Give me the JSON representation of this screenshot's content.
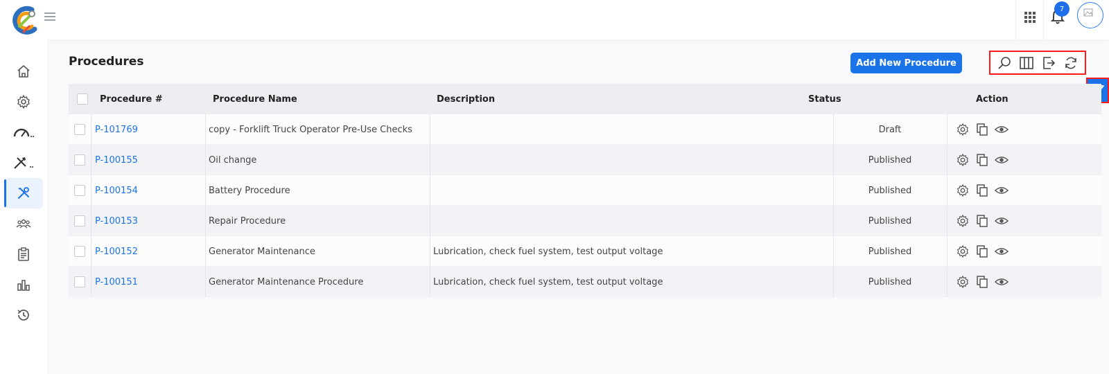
{
  "page": {
    "title": "Procedures"
  },
  "header": {
    "notification_count": "7"
  },
  "toolbar": {
    "add_label": "Add New Procedure"
  },
  "table": {
    "columns": [
      "Procedure #",
      "Procedure Name",
      "Description",
      "Status",
      "Action"
    ],
    "rows": [
      {
        "id": "P-101769",
        "name": "copy - Forklift Truck Operator Pre-Use Checks",
        "description": "",
        "status": "Draft"
      },
      {
        "id": "P-100155",
        "name": "Oil change",
        "description": "",
        "status": "Published"
      },
      {
        "id": "P-100154",
        "name": "Battery Procedure",
        "description": "",
        "status": "Published"
      },
      {
        "id": "P-100153",
        "name": "Repair Procedure",
        "description": "",
        "status": "Published"
      },
      {
        "id": "P-100152",
        "name": "Generator Maintenance",
        "description": "Lubrication, check fuel system, test output voltage",
        "status": "Published"
      },
      {
        "id": "P-100151",
        "name": "Generator Maintenance Procedure",
        "description": "Lubrication, check fuel system, test output voltage",
        "status": "Published"
      }
    ]
  },
  "sidebar": {
    "items": [
      {
        "icon": "home-icon"
      },
      {
        "icon": "gear-icon"
      },
      {
        "icon": "gauge-icon"
      },
      {
        "icon": "tools-icon"
      },
      {
        "icon": "wrench-screwdriver-icon",
        "active": true
      },
      {
        "icon": "team-icon"
      },
      {
        "icon": "clipboard-icon"
      },
      {
        "icon": "bar-chart-icon"
      },
      {
        "icon": "history-icon"
      }
    ]
  },
  "colors": {
    "accent": "#1a73e8",
    "highlight": "#ff1a1a"
  }
}
